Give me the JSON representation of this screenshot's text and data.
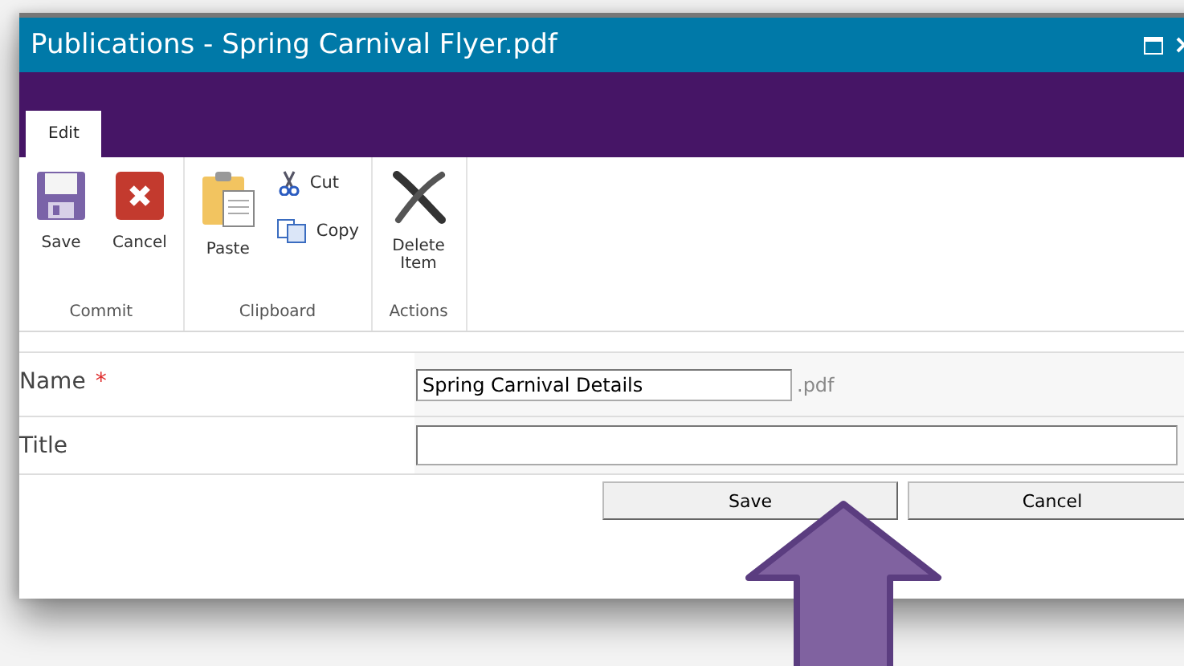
{
  "window": {
    "title": "Publications - Spring Carnival Flyer.pdf"
  },
  "tabs": [
    {
      "label": "Edit",
      "selected": true
    }
  ],
  "ribbon": {
    "groups": [
      {
        "label": "Commit",
        "items": [
          {
            "label": "Save",
            "kind": "large"
          },
          {
            "label": "Cancel",
            "kind": "large"
          }
        ]
      },
      {
        "label": "Clipboard",
        "items": [
          {
            "label": "Paste",
            "kind": "large"
          },
          {
            "label": "Cut",
            "kind": "small"
          },
          {
            "label": "Copy",
            "kind": "small"
          }
        ]
      },
      {
        "label": "Actions",
        "items": [
          {
            "label": "Delete Item",
            "kind": "large"
          }
        ]
      }
    ]
  },
  "form": {
    "fields": [
      {
        "label": "Name",
        "required_mark": "*",
        "value": "Spring Carnival Details",
        "suffix": ".pdf",
        "kind": "short"
      },
      {
        "label": "Title",
        "kind": "wide"
      }
    ]
  },
  "buttons": [
    "Save",
    "Cancel"
  ]
}
